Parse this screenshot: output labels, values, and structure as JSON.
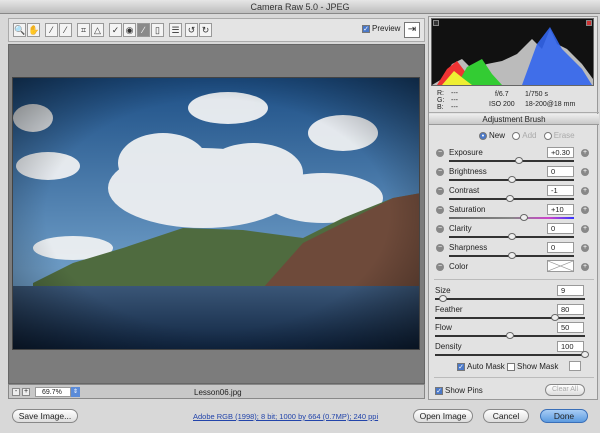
{
  "window": {
    "title": "Camera Raw 5.0  -  JPEG"
  },
  "toolbar": {
    "tools": [
      {
        "name": "zoom-icon",
        "glyph": "🔍"
      },
      {
        "name": "hand-icon",
        "glyph": "✋"
      },
      {
        "name": "white-balance-icon",
        "glyph": "⁄"
      },
      {
        "name": "color-sampler-icon",
        "glyph": "⁄"
      },
      {
        "name": "crop-icon",
        "glyph": "⌗"
      },
      {
        "name": "straighten-icon",
        "glyph": "△"
      },
      {
        "name": "spot-removal-icon",
        "glyph": "✓"
      },
      {
        "name": "red-eye-icon",
        "glyph": "◉"
      },
      {
        "name": "adjustment-brush-icon",
        "glyph": "∕"
      },
      {
        "name": "graduated-filter-icon",
        "glyph": "▯"
      },
      {
        "name": "preferences-icon",
        "glyph": "☰"
      },
      {
        "name": "rotate-ccw-icon",
        "glyph": "↺"
      },
      {
        "name": "rotate-cw-icon",
        "glyph": "↻"
      }
    ],
    "preview_label": "Preview",
    "preview_checked": true
  },
  "info": {
    "r": "R:",
    "g": "G:",
    "b": "B:",
    "dash": "---",
    "aperture": "f/6.7",
    "shutter": "1/750 s",
    "iso": "ISO 200",
    "lens": "18-200@18 mm"
  },
  "panel": {
    "title": "Adjustment Brush",
    "modes": [
      "New",
      "Add",
      "Erase"
    ],
    "mode_selected": "New",
    "sliders": [
      {
        "label": "Exposure",
        "value": "+0.30",
        "pos": 0.56
      },
      {
        "label": "Brightness",
        "value": "0",
        "pos": 0.5
      },
      {
        "label": "Contrast",
        "value": "-1",
        "pos": 0.49
      },
      {
        "label": "Saturation",
        "value": "+10",
        "pos": 0.6
      },
      {
        "label": "Clarity",
        "value": "0",
        "pos": 0.5
      },
      {
        "label": "Sharpness",
        "value": "0",
        "pos": 0.5
      }
    ],
    "color_label": "Color",
    "brush": [
      {
        "label": "Size",
        "value": "9",
        "pos": 0.05
      },
      {
        "label": "Feather",
        "value": "80",
        "pos": 0.8
      },
      {
        "label": "Flow",
        "value": "50",
        "pos": 0.5
      },
      {
        "label": "Density",
        "value": "100",
        "pos": 1.0
      }
    ],
    "auto_mask": "Auto Mask",
    "auto_mask_checked": true,
    "show_mask": "Show Mask",
    "show_mask_checked": false,
    "show_pins": "Show Pins",
    "show_pins_checked": true,
    "clear_all": "Clear All"
  },
  "status": {
    "zoom": "69.7%",
    "filename": "Lesson06.jpg"
  },
  "footer": {
    "save": "Save Image...",
    "workflow": "Adobe RGB (1998); 8 bit; 1000 by 664 (0.7MP); 240 ppi",
    "open": "Open Image",
    "cancel": "Cancel",
    "done": "Done"
  }
}
